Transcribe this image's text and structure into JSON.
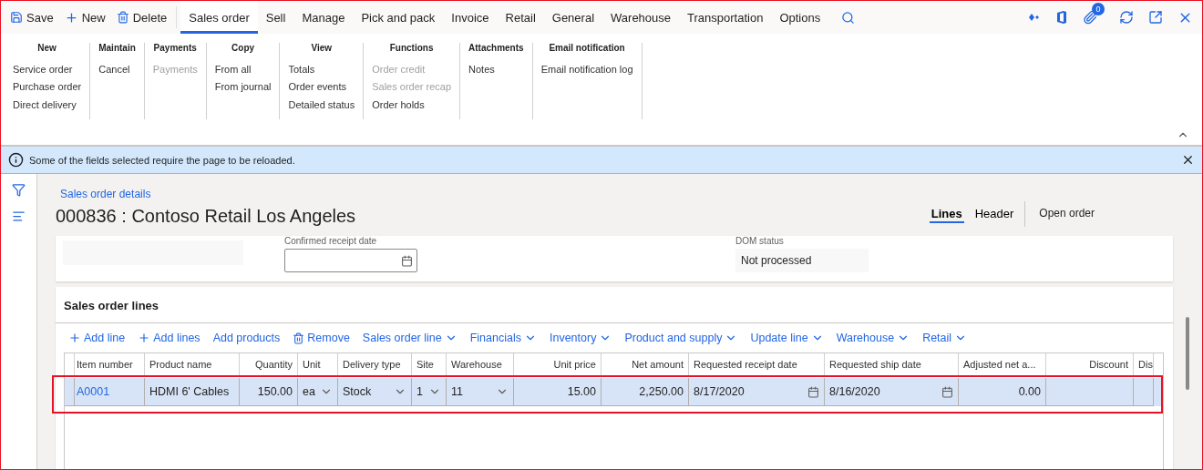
{
  "action_bar": {
    "buttons": [
      {
        "kind": "save",
        "label": "Save"
      },
      {
        "kind": "new",
        "label": "New"
      },
      {
        "kind": "delete",
        "label": "Delete"
      }
    ],
    "tabs": [
      {
        "label": "Sales order",
        "selected": true
      },
      {
        "label": "Sell",
        "selected": false
      },
      {
        "label": "Manage",
        "selected": false
      },
      {
        "label": "Pick and pack",
        "selected": false
      },
      {
        "label": "Invoice",
        "selected": false
      },
      {
        "label": "Retail",
        "selected": false
      },
      {
        "label": "General",
        "selected": false
      },
      {
        "label": "Warehouse",
        "selected": false
      },
      {
        "label": "Transportation",
        "selected": false
      },
      {
        "label": "Options",
        "selected": false
      }
    ],
    "attachments_count": "0"
  },
  "ribbon": {
    "groups": [
      {
        "title": "New",
        "items": [
          {
            "label": "Service order",
            "disabled": false
          },
          {
            "label": "Purchase order",
            "disabled": false
          },
          {
            "label": "Direct delivery",
            "disabled": false
          }
        ]
      },
      {
        "title": "Maintain",
        "items": [
          {
            "label": "Cancel",
            "disabled": false
          }
        ]
      },
      {
        "title": "Payments",
        "items": [
          {
            "label": "Payments",
            "disabled": true
          }
        ]
      },
      {
        "title": "Copy",
        "items": [
          {
            "label": "From all",
            "disabled": false
          },
          {
            "label": "From journal",
            "disabled": false
          }
        ]
      },
      {
        "title": "View",
        "items": [
          {
            "label": "Totals",
            "disabled": false
          },
          {
            "label": "Order events",
            "disabled": false
          },
          {
            "label": "Detailed status",
            "disabled": false
          }
        ]
      },
      {
        "title": "Functions",
        "items": [
          {
            "label": "Order credit",
            "disabled": true
          },
          {
            "label": "Sales order recap",
            "disabled": true
          },
          {
            "label": "Order holds",
            "disabled": false
          }
        ]
      },
      {
        "title": "Attachments",
        "items": [
          {
            "label": "Notes",
            "disabled": false
          }
        ]
      },
      {
        "title": "Email notification",
        "items": [
          {
            "label": "Email notification log",
            "disabled": false
          }
        ]
      }
    ]
  },
  "info_bar": {
    "message": "Some of the fields selected require the page to be reloaded."
  },
  "page": {
    "breadcrumb": "Sales order details",
    "title": "000836 : Contoso Retail Los Angeles",
    "view_tabs": [
      {
        "label": "Lines",
        "selected": true
      },
      {
        "label": "Header",
        "selected": false
      }
    ],
    "status": "Open order"
  },
  "header_fields": [
    {
      "kind": "blank"
    },
    {
      "kind": "date",
      "label": "Confirmed receipt date"
    },
    {
      "kind": "readonly",
      "label": "DOM status",
      "value": "Not processed"
    }
  ],
  "lines": {
    "title": "Sales order lines",
    "toolbar": [
      {
        "kind": "add",
        "label": "Add line"
      },
      {
        "kind": "add-multi",
        "label": "Add lines"
      },
      {
        "kind": "plain",
        "label": "Add products"
      },
      {
        "kind": "remove",
        "label": "Remove"
      },
      {
        "kind": "menu",
        "label": "Sales order line"
      },
      {
        "kind": "menu",
        "label": "Financials"
      },
      {
        "kind": "menu",
        "label": "Inventory"
      },
      {
        "kind": "menu",
        "label": "Product and supply"
      },
      {
        "kind": "menu",
        "label": "Update line"
      },
      {
        "kind": "menu",
        "label": "Warehouse"
      },
      {
        "kind": "menu",
        "label": "Retail"
      }
    ],
    "columns": [
      "Item number",
      "Product name",
      "Quantity",
      "Unit",
      "Delivery type",
      "Site",
      "Warehouse",
      "Unit price",
      "Net amount",
      "Requested receipt date",
      "Requested ship date",
      "Adjusted net a...",
      "Discount",
      "Dis"
    ],
    "rows": [
      {
        "selected": true,
        "outlined": true,
        "cells": [
          {
            "kind": "link",
            "value": "A0001"
          },
          {
            "kind": "text",
            "value": "HDMI 6' Cables"
          },
          {
            "kind": "number",
            "value": "150.00"
          },
          {
            "kind": "dropdown",
            "value": "ea"
          },
          {
            "kind": "dropdown",
            "value": "Stock"
          },
          {
            "kind": "dropdown",
            "value": "1"
          },
          {
            "kind": "dropdown",
            "value": "11"
          },
          {
            "kind": "number",
            "value": "15.00"
          },
          {
            "kind": "number",
            "value": "2,250.00"
          },
          {
            "kind": "date",
            "value": "8/17/2020"
          },
          {
            "kind": "date",
            "value": "8/16/2020"
          },
          {
            "kind": "number",
            "value": "0.00"
          },
          {
            "kind": "empty"
          },
          {
            "kind": "empty"
          }
        ]
      }
    ]
  }
}
